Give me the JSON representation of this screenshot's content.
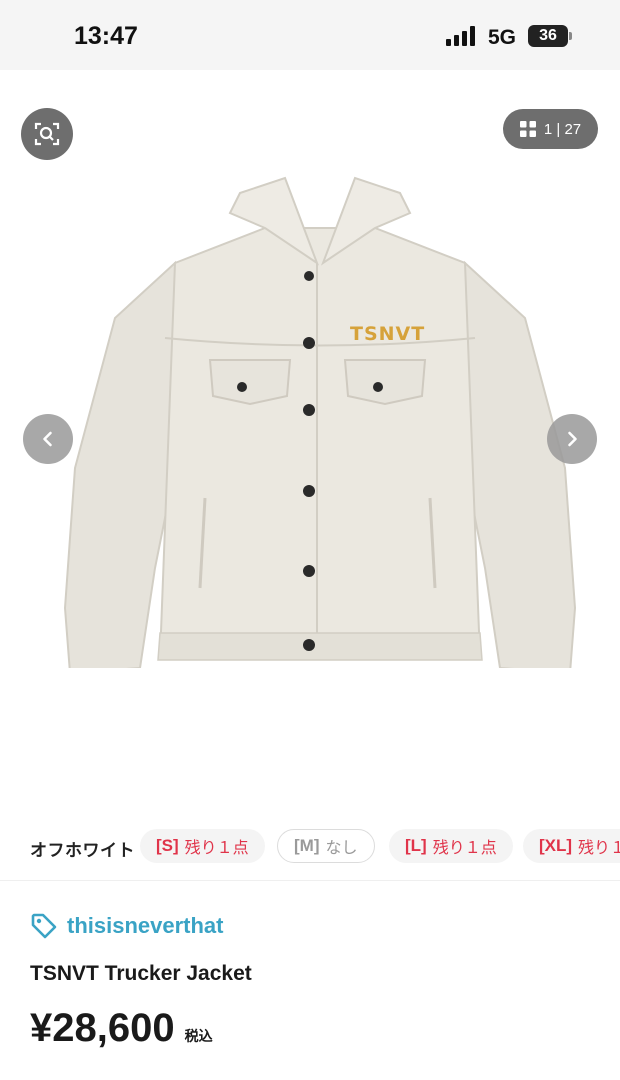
{
  "status_bar": {
    "time": "13:47",
    "network": "5G",
    "battery": "36"
  },
  "gallery": {
    "counter_current": "1",
    "counter_separator": "|",
    "counter_total": "27",
    "jacket_print": "TSNVT"
  },
  "variants": {
    "color_name": "オフホワイト",
    "sizes": [
      {
        "size": "[S]",
        "stock": "残り１点",
        "available": true
      },
      {
        "size": "[M]",
        "stock": "なし",
        "available": false
      },
      {
        "size": "[L]",
        "stock": "残り１点",
        "available": true
      },
      {
        "size": "[XL]",
        "stock": "残り１",
        "available": true
      }
    ]
  },
  "product": {
    "brand": "thisisneverthat",
    "title": "TSNVT Trucker Jacket",
    "price": "¥28,600",
    "tax_label": "税込"
  },
  "colors": {
    "brand_accent": "#3aa3c5",
    "stock_red": "#e0344a",
    "jacket_fabric": "#e9e6de",
    "print_mustard": "#d6a23a"
  }
}
